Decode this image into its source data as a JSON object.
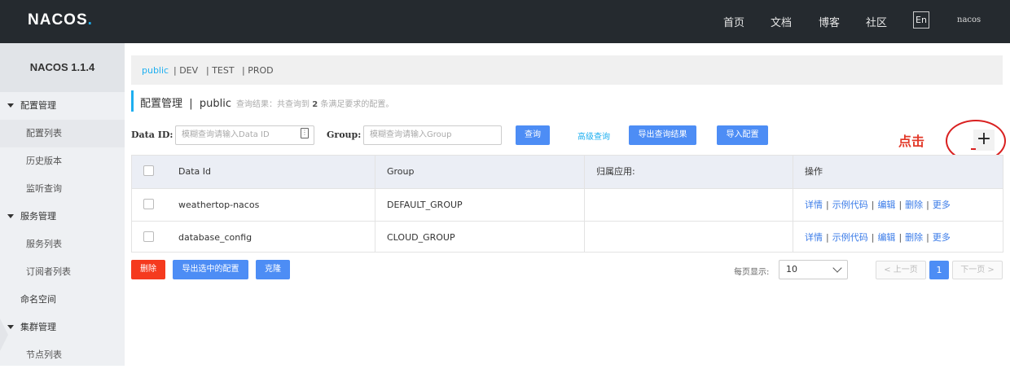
{
  "header": {
    "logo": "NACOS",
    "logo_dot": ".",
    "nav": [
      "首页",
      "文档",
      "博客",
      "社区"
    ],
    "lang": "En",
    "user": "nacos"
  },
  "sidebar": {
    "version": "NACOS 1.1.4",
    "items": [
      {
        "label": "配置管理",
        "type": "group"
      },
      {
        "label": "配置列表",
        "type": "sub"
      },
      {
        "label": "历史版本",
        "type": "sub"
      },
      {
        "label": "监听查询",
        "type": "sub"
      },
      {
        "label": "服务管理",
        "type": "group"
      },
      {
        "label": "服务列表",
        "type": "sub"
      },
      {
        "label": "订阅者列表",
        "type": "sub"
      },
      {
        "label": "命名空间",
        "type": "plain"
      },
      {
        "label": "集群管理",
        "type": "group"
      },
      {
        "label": "节点列表",
        "type": "sub"
      }
    ]
  },
  "env_tabs": [
    "public",
    "| DEV",
    "| TEST",
    "| PROD"
  ],
  "page": {
    "title": "配置管理  |  public",
    "result_prefix": "查询结果：共查询到 ",
    "result_count": "2",
    "result_suffix": " 条满足要求的配置。"
  },
  "search": {
    "data_id_label": "Data ID:",
    "data_id_placeholder": "模糊查询请输入Data ID",
    "group_label": "Group:",
    "group_placeholder": "模糊查询请输入Group",
    "query_button": "查询",
    "advanced_link": "高级查询",
    "export_button": "导出查询结果",
    "import_button": "导入配置"
  },
  "annotation": {
    "text": "点击",
    "plus": "+"
  },
  "table": {
    "columns": [
      "Data Id",
      "Group",
      "归属应用:",
      "操作"
    ],
    "rows": [
      {
        "data_id": "weathertop-nacos",
        "group": "DEFAULT_GROUP",
        "app": ""
      },
      {
        "data_id": "database_config",
        "group": "CLOUD_GROUP",
        "app": ""
      }
    ],
    "ops": [
      "详情",
      "示例代码",
      "编辑",
      "删除",
      "更多"
    ]
  },
  "footer": {
    "delete_button": "删除",
    "export_selected_button": "导出选中的配置",
    "clone_button": "克隆",
    "page_size_label": "每页显示:",
    "page_size": "10",
    "prev": "< 上一页",
    "current_page": "1",
    "next": "下一页 >"
  },
  "colors": {
    "accent": "#1eaff0",
    "primary": "#4d8df5",
    "danger": "#f53a1e",
    "header": "#252a2f"
  }
}
